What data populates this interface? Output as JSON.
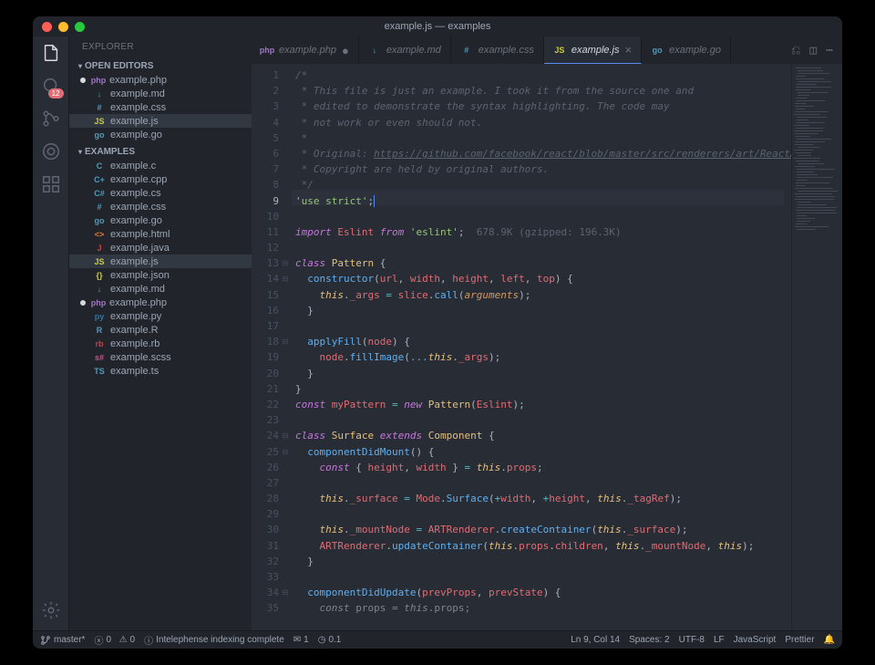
{
  "title": "example.js — examples",
  "activitybar": {
    "badge": "12",
    "items": [
      "explorer",
      "search",
      "scm",
      "debug",
      "extensions"
    ]
  },
  "sidebar": {
    "header": "EXPLORER",
    "sections": [
      {
        "title": "OPEN EDITORS",
        "files": [
          {
            "name": "example.php",
            "color": "#a074c4",
            "lbl": "php",
            "dirty": true
          },
          {
            "name": "example.md",
            "color": "#519aba",
            "lbl": "↓"
          },
          {
            "name": "example.css",
            "color": "#519aba",
            "lbl": "#"
          },
          {
            "name": "example.js",
            "color": "#cbcb41",
            "lbl": "JS",
            "sel": true
          },
          {
            "name": "example.go",
            "color": "#519aba",
            "lbl": "go"
          }
        ]
      },
      {
        "title": "EXAMPLES",
        "files": [
          {
            "name": "example.c",
            "color": "#519aba",
            "lbl": "C"
          },
          {
            "name": "example.cpp",
            "color": "#519aba",
            "lbl": "C+"
          },
          {
            "name": "example.cs",
            "color": "#519aba",
            "lbl": "C#"
          },
          {
            "name": "example.css",
            "color": "#519aba",
            "lbl": "#"
          },
          {
            "name": "example.go",
            "color": "#519aba",
            "lbl": "go"
          },
          {
            "name": "example.html",
            "color": "#e37933",
            "lbl": "<>"
          },
          {
            "name": "example.java",
            "color": "#cc3e44",
            "lbl": "J"
          },
          {
            "name": "example.js",
            "color": "#cbcb41",
            "lbl": "JS",
            "sel": true
          },
          {
            "name": "example.json",
            "color": "#cbcb41",
            "lbl": "{}"
          },
          {
            "name": "example.md",
            "color": "#519aba",
            "lbl": "↓"
          },
          {
            "name": "example.php",
            "color": "#a074c4",
            "lbl": "php",
            "dirty": true
          },
          {
            "name": "example.py",
            "color": "#3572A5",
            "lbl": "py"
          },
          {
            "name": "example.R",
            "color": "#519aba",
            "lbl": "R"
          },
          {
            "name": "example.rb",
            "color": "#cc3e44",
            "lbl": "rb"
          },
          {
            "name": "example.scss",
            "color": "#c6538c",
            "lbl": "s#"
          },
          {
            "name": "example.ts",
            "color": "#519aba",
            "lbl": "TS"
          }
        ]
      }
    ]
  },
  "tabs": [
    {
      "name": "example.php",
      "color": "#a074c4",
      "lbl": "php",
      "dirty": true
    },
    {
      "name": "example.md",
      "color": "#519aba",
      "lbl": "↓"
    },
    {
      "name": "example.css",
      "color": "#519aba",
      "lbl": "#"
    },
    {
      "name": "example.js",
      "color": "#cbcb41",
      "lbl": "JS",
      "active": true
    },
    {
      "name": "example.go",
      "color": "#519aba",
      "lbl": "go"
    }
  ],
  "code": {
    "highlight_line": 9,
    "lines": [
      {
        "n": 1,
        "t": "cmt",
        "txt": "/*"
      },
      {
        "n": 2,
        "t": "cmt",
        "txt": " * This file is just an example. I took it from the source one and"
      },
      {
        "n": 3,
        "t": "cmt",
        "txt": " * edited to demonstrate the syntax highlighting. The code may"
      },
      {
        "n": 4,
        "t": "cmt",
        "txt": " * not work or even should not."
      },
      {
        "n": 5,
        "t": "cmt",
        "txt": " *"
      },
      {
        "n": 6,
        "t": "link",
        "pre": " * Original: ",
        "link": "https://github.com/facebook/react/blob/master/src/renderers/art/ReactA"
      },
      {
        "n": 7,
        "t": "cmt",
        "txt": " * Copyright are held by original authors."
      },
      {
        "n": 8,
        "t": "cmt",
        "txt": " */"
      },
      {
        "n": 9,
        "t": "strict"
      },
      {
        "n": 10,
        "t": "blank"
      },
      {
        "n": 11,
        "t": "import",
        "size": "678.9K (gzipped: 196.3K)"
      },
      {
        "n": 12,
        "t": "blank"
      },
      {
        "n": 13,
        "t": "classdef",
        "name": "Pattern",
        "fold": true
      },
      {
        "n": 14,
        "t": "ctor",
        "fold": true
      },
      {
        "n": 15,
        "t": "argsassign"
      },
      {
        "n": 16,
        "t": "close1"
      },
      {
        "n": 17,
        "t": "blank"
      },
      {
        "n": 18,
        "t": "method",
        "name": "applyFill",
        "arg": "node",
        "fold": true
      },
      {
        "n": 19,
        "t": "fillimg"
      },
      {
        "n": 20,
        "t": "close1"
      },
      {
        "n": 21,
        "t": "close0"
      },
      {
        "n": 22,
        "t": "mypattern"
      },
      {
        "n": 23,
        "t": "blank"
      },
      {
        "n": 24,
        "t": "classext",
        "name": "Surface",
        "ext": "Component",
        "fold": true
      },
      {
        "n": 25,
        "t": "method0",
        "name": "componentDidMount",
        "fold": true
      },
      {
        "n": 26,
        "t": "destruct"
      },
      {
        "n": 27,
        "t": "blank"
      },
      {
        "n": 28,
        "t": "surface"
      },
      {
        "n": 29,
        "t": "blank"
      },
      {
        "n": 30,
        "t": "mountnode"
      },
      {
        "n": 31,
        "t": "updatecontainer"
      },
      {
        "n": 32,
        "t": "close1"
      },
      {
        "n": 33,
        "t": "blank"
      },
      {
        "n": 34,
        "t": "method2",
        "name": "componentDidUpdate",
        "a1": "prevProps",
        "a2": "prevState",
        "fold": true
      },
      {
        "n": 35,
        "t": "propseq"
      }
    ]
  },
  "statusbar": {
    "branch": "master*",
    "errors": "0",
    "warnings": "0",
    "intelephense": "Intelephense indexing complete",
    "notif": "1",
    "timer": "0.1",
    "cursor": "Ln 9, Col 14",
    "spaces": "Spaces: 2",
    "encoding": "UTF-8",
    "eol": "LF",
    "lang": "JavaScript",
    "prettier": "Prettier"
  }
}
